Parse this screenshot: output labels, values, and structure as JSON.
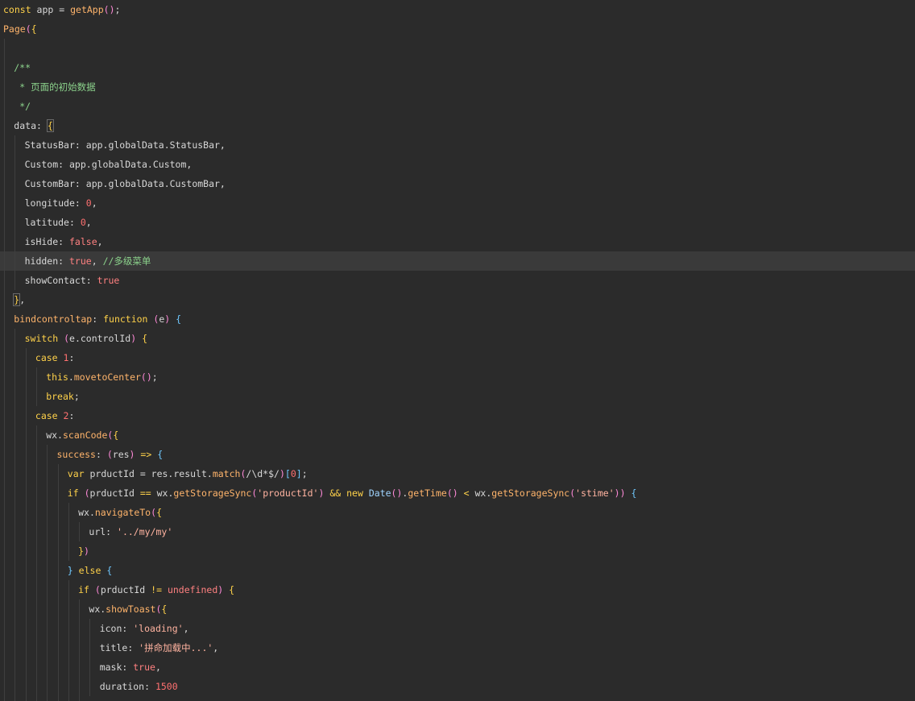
{
  "editor": {
    "lines": [
      {
        "indent": 0,
        "tokens": [
          {
            "t": "const ",
            "k": "kw"
          },
          {
            "t": "app",
            "k": "plain"
          },
          {
            "t": " = ",
            "k": "plain"
          },
          {
            "t": "getApp",
            "k": "fn"
          },
          {
            "t": "(",
            "k": "paren"
          },
          {
            "t": ")",
            "k": "paren"
          },
          {
            "t": ";",
            "k": "plain"
          }
        ]
      },
      {
        "indent": 0,
        "tokens": [
          {
            "t": "Page",
            "k": "fn"
          },
          {
            "t": "(",
            "k": "paren"
          },
          {
            "t": "{",
            "k": "brace"
          }
        ]
      },
      {
        "indent": 1,
        "tokens": []
      },
      {
        "indent": 1,
        "tokens": [
          {
            "t": "/**",
            "k": "comment"
          }
        ]
      },
      {
        "indent": 1,
        "tokens": [
          {
            "t": " * 页面的初始数据",
            "k": "comment"
          }
        ]
      },
      {
        "indent": 1,
        "tokens": [
          {
            "t": " */",
            "k": "comment"
          }
        ]
      },
      {
        "indent": 1,
        "tokens": [
          {
            "t": "data",
            "k": "key"
          },
          {
            "t": ": ",
            "k": "plain"
          },
          {
            "t": "{",
            "k": "hl-brace"
          }
        ]
      },
      {
        "indent": 2,
        "tokens": [
          {
            "t": "StatusBar",
            "k": "key"
          },
          {
            "t": ": ",
            "k": "plain"
          },
          {
            "t": "app.globalData.StatusBar,",
            "k": "plain"
          }
        ]
      },
      {
        "indent": 2,
        "tokens": [
          {
            "t": "Custom",
            "k": "key"
          },
          {
            "t": ": ",
            "k": "plain"
          },
          {
            "t": "app.globalData.Custom,",
            "k": "plain"
          }
        ]
      },
      {
        "indent": 2,
        "tokens": [
          {
            "t": "CustomBar",
            "k": "key"
          },
          {
            "t": ": ",
            "k": "plain"
          },
          {
            "t": "app.globalData.CustomBar,",
            "k": "plain"
          }
        ]
      },
      {
        "indent": 2,
        "tokens": [
          {
            "t": "longitude",
            "k": "key"
          },
          {
            "t": ": ",
            "k": "plain"
          },
          {
            "t": "0",
            "k": "num"
          },
          {
            "t": ",",
            "k": "plain"
          }
        ]
      },
      {
        "indent": 2,
        "tokens": [
          {
            "t": "latitude",
            "k": "key"
          },
          {
            "t": ": ",
            "k": "plain"
          },
          {
            "t": "0",
            "k": "num"
          },
          {
            "t": ",",
            "k": "plain"
          }
        ]
      },
      {
        "indent": 2,
        "tokens": [
          {
            "t": "isHide",
            "k": "key"
          },
          {
            "t": ": ",
            "k": "plain"
          },
          {
            "t": "false",
            "k": "bool"
          },
          {
            "t": ",",
            "k": "plain"
          }
        ]
      },
      {
        "indent": 2,
        "current": true,
        "tokens": [
          {
            "t": "hidden",
            "k": "key"
          },
          {
            "t": ": ",
            "k": "plain"
          },
          {
            "t": "true",
            "k": "bool"
          },
          {
            "t": ", ",
            "k": "plain"
          },
          {
            "t": "//多级菜单",
            "k": "comment"
          }
        ]
      },
      {
        "indent": 2,
        "tokens": [
          {
            "t": "showContact",
            "k": "key"
          },
          {
            "t": ": ",
            "k": "plain"
          },
          {
            "t": "true",
            "k": "bool"
          }
        ]
      },
      {
        "indent": 1,
        "tokens": [
          {
            "t": "}",
            "k": "hl-brace"
          },
          {
            "t": ",",
            "k": "plain"
          }
        ]
      },
      {
        "indent": 1,
        "tokens": [
          {
            "t": "bindcontroltap",
            "k": "fn"
          },
          {
            "t": ": ",
            "k": "plain"
          },
          {
            "t": "function",
            "k": "kw"
          },
          {
            "t": " ",
            "k": "plain"
          },
          {
            "t": "(",
            "k": "paren"
          },
          {
            "t": "e",
            "k": "plain"
          },
          {
            "t": ")",
            "k": "paren"
          },
          {
            "t": " ",
            "k": "plain"
          },
          {
            "t": "{",
            "k": "bracket"
          }
        ]
      },
      {
        "indent": 2,
        "tokens": [
          {
            "t": "switch",
            "k": "kw"
          },
          {
            "t": " ",
            "k": "plain"
          },
          {
            "t": "(",
            "k": "paren"
          },
          {
            "t": "e.controlId",
            "k": "plain"
          },
          {
            "t": ")",
            "k": "paren"
          },
          {
            "t": " ",
            "k": "plain"
          },
          {
            "t": "{",
            "k": "brace"
          }
        ]
      },
      {
        "indent": 3,
        "tokens": [
          {
            "t": "case",
            "k": "kw"
          },
          {
            "t": " ",
            "k": "plain"
          },
          {
            "t": "1",
            "k": "num"
          },
          {
            "t": ":",
            "k": "plain"
          }
        ]
      },
      {
        "indent": 4,
        "tokens": [
          {
            "t": "this",
            "k": "kw"
          },
          {
            "t": ".",
            "k": "plain"
          },
          {
            "t": "movetoCenter",
            "k": "fn"
          },
          {
            "t": "(",
            "k": "paren"
          },
          {
            "t": ")",
            "k": "paren"
          },
          {
            "t": ";",
            "k": "plain"
          }
        ]
      },
      {
        "indent": 4,
        "tokens": [
          {
            "t": "break",
            "k": "kw"
          },
          {
            "t": ";",
            "k": "plain"
          }
        ]
      },
      {
        "indent": 3,
        "tokens": [
          {
            "t": "case",
            "k": "kw"
          },
          {
            "t": " ",
            "k": "plain"
          },
          {
            "t": "2",
            "k": "num"
          },
          {
            "t": ":",
            "k": "plain"
          }
        ]
      },
      {
        "indent": 4,
        "tokens": [
          {
            "t": "wx",
            "k": "plain"
          },
          {
            "t": ".",
            "k": "plain"
          },
          {
            "t": "scanCode",
            "k": "fn"
          },
          {
            "t": "(",
            "k": "paren"
          },
          {
            "t": "{",
            "k": "brace"
          }
        ]
      },
      {
        "indent": 5,
        "tokens": [
          {
            "t": "success",
            "k": "fn"
          },
          {
            "t": ": ",
            "k": "plain"
          },
          {
            "t": "(",
            "k": "paren"
          },
          {
            "t": "res",
            "k": "plain"
          },
          {
            "t": ")",
            "k": "paren"
          },
          {
            "t": " => ",
            "k": "op"
          },
          {
            "t": "{",
            "k": "bracket"
          }
        ]
      },
      {
        "indent": 6,
        "tokens": [
          {
            "t": "var",
            "k": "kw"
          },
          {
            "t": " prductId = res.result.",
            "k": "plain"
          },
          {
            "t": "match",
            "k": "fn"
          },
          {
            "t": "(",
            "k": "paren"
          },
          {
            "t": "/\\d*$/",
            "k": "plain"
          },
          {
            "t": ")",
            "k": "paren"
          },
          {
            "t": "[",
            "k": "bracket"
          },
          {
            "t": "0",
            "k": "num"
          },
          {
            "t": "]",
            "k": "bracket"
          },
          {
            "t": ";",
            "k": "plain"
          }
        ]
      },
      {
        "indent": 6,
        "tokens": [
          {
            "t": "if",
            "k": "kw"
          },
          {
            "t": " ",
            "k": "plain"
          },
          {
            "t": "(",
            "k": "paren"
          },
          {
            "t": "prductId ",
            "k": "plain"
          },
          {
            "t": "==",
            "k": "op"
          },
          {
            "t": " wx.",
            "k": "plain"
          },
          {
            "t": "getStorageSync",
            "k": "fn"
          },
          {
            "t": "(",
            "k": "paren"
          },
          {
            "t": "'productId'",
            "k": "str"
          },
          {
            "t": ")",
            "k": "paren"
          },
          {
            "t": " ",
            "k": "plain"
          },
          {
            "t": "&&",
            "k": "op"
          },
          {
            "t": " ",
            "k": "plain"
          },
          {
            "t": "new",
            "k": "kw"
          },
          {
            "t": " ",
            "k": "plain"
          },
          {
            "t": "Date",
            "k": "type"
          },
          {
            "t": "(",
            "k": "paren"
          },
          {
            "t": ")",
            "k": "paren"
          },
          {
            "t": ".",
            "k": "plain"
          },
          {
            "t": "getTime",
            "k": "fn"
          },
          {
            "t": "(",
            "k": "paren"
          },
          {
            "t": ")",
            "k": "paren"
          },
          {
            "t": " ",
            "k": "plain"
          },
          {
            "t": "<",
            "k": "op"
          },
          {
            "t": " wx.",
            "k": "plain"
          },
          {
            "t": "getStorageSync",
            "k": "fn"
          },
          {
            "t": "(",
            "k": "paren"
          },
          {
            "t": "'stime'",
            "k": "str"
          },
          {
            "t": ")",
            "k": "paren"
          },
          {
            "t": ")",
            "k": "paren"
          },
          {
            "t": " ",
            "k": "plain"
          },
          {
            "t": "{",
            "k": "bracket"
          }
        ]
      },
      {
        "indent": 7,
        "tokens": [
          {
            "t": "wx.",
            "k": "plain"
          },
          {
            "t": "navigateTo",
            "k": "fn"
          },
          {
            "t": "(",
            "k": "paren"
          },
          {
            "t": "{",
            "k": "brace"
          }
        ]
      },
      {
        "indent": 8,
        "tokens": [
          {
            "t": "url",
            "k": "key"
          },
          {
            "t": ": ",
            "k": "plain"
          },
          {
            "t": "'../my/my'",
            "k": "str"
          }
        ]
      },
      {
        "indent": 7,
        "tokens": [
          {
            "t": "}",
            "k": "brace"
          },
          {
            "t": ")",
            "k": "paren"
          }
        ]
      },
      {
        "indent": 6,
        "tokens": [
          {
            "t": "}",
            "k": "bracket"
          },
          {
            "t": " ",
            "k": "plain"
          },
          {
            "t": "else",
            "k": "kw"
          },
          {
            "t": " ",
            "k": "plain"
          },
          {
            "t": "{",
            "k": "bracket"
          }
        ]
      },
      {
        "indent": 7,
        "tokens": [
          {
            "t": "if",
            "k": "kw"
          },
          {
            "t": " ",
            "k": "plain"
          },
          {
            "t": "(",
            "k": "paren"
          },
          {
            "t": "prductId ",
            "k": "plain"
          },
          {
            "t": "!=",
            "k": "op"
          },
          {
            "t": " ",
            "k": "plain"
          },
          {
            "t": "undefined",
            "k": "bool"
          },
          {
            "t": ")",
            "k": "paren"
          },
          {
            "t": " ",
            "k": "plain"
          },
          {
            "t": "{",
            "k": "brace"
          }
        ]
      },
      {
        "indent": 8,
        "tokens": [
          {
            "t": "wx.",
            "k": "plain"
          },
          {
            "t": "showToast",
            "k": "fn"
          },
          {
            "t": "(",
            "k": "paren"
          },
          {
            "t": "{",
            "k": "brace"
          }
        ]
      },
      {
        "indent": 9,
        "tokens": [
          {
            "t": "icon",
            "k": "key"
          },
          {
            "t": ": ",
            "k": "plain"
          },
          {
            "t": "'loading'",
            "k": "str"
          },
          {
            "t": ",",
            "k": "plain"
          }
        ]
      },
      {
        "indent": 9,
        "tokens": [
          {
            "t": "title",
            "k": "key"
          },
          {
            "t": ": ",
            "k": "plain"
          },
          {
            "t": "'拼命加载中...'",
            "k": "str"
          },
          {
            "t": ",",
            "k": "plain"
          }
        ]
      },
      {
        "indent": 9,
        "tokens": [
          {
            "t": "mask",
            "k": "key"
          },
          {
            "t": ": ",
            "k": "plain"
          },
          {
            "t": "true",
            "k": "bool"
          },
          {
            "t": ",",
            "k": "plain"
          }
        ]
      },
      {
        "indent": 9,
        "tokens": [
          {
            "t": "duration",
            "k": "key"
          },
          {
            "t": ": ",
            "k": "plain"
          },
          {
            "t": "1500",
            "k": "num"
          }
        ]
      },
      {
        "indent": 8,
        "tokens": [
          {
            "t": "}",
            "k": "brace"
          },
          {
            "t": ")",
            "k": "paren"
          }
        ]
      }
    ]
  }
}
